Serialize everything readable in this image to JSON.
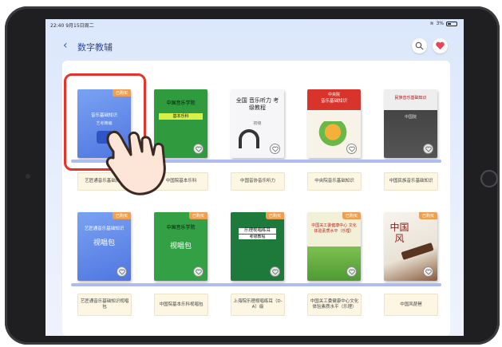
{
  "status_bar": {
    "time": "22:40  9月15日周二",
    "battery": "3%"
  },
  "header": {
    "back_icon": "chevron-left-icon",
    "title": "数字教辅",
    "search_icon": "search-icon",
    "favorite_icon": "heart-icon"
  },
  "colors": {
    "accent": "#2e4a9a",
    "favorite": "#e8455a",
    "highlight": "#e8332a",
    "shelf": "#aebcf0",
    "tag": "#f0a04b"
  },
  "books_row1": [
    {
      "cover_title": "音乐基础知识",
      "cover_sub": "艺考精编",
      "tag": "已购买",
      "label": "艺匠通音乐基础知识"
    },
    {
      "cover_title": "中国音乐学院",
      "cover_sub": "基本乐科",
      "tag": "",
      "label": "中国院基本乐科"
    },
    {
      "cover_title": "全国 音乐听力 考级教程",
      "cover_sub": "初级",
      "tag": "",
      "label": "中国音协音乐听力"
    },
    {
      "cover_title": "音乐基础知识",
      "cover_sub": "中央院",
      "tag": "",
      "label": "中央院音乐基础知识"
    },
    {
      "cover_title": "民族音乐基础知识",
      "cover_sub": "中国院",
      "tag": "",
      "label": "中国民族音乐基础知识"
    }
  ],
  "books_row2": [
    {
      "cover_title": "艺匠通音乐基础知识",
      "cover_sub": "视唱包",
      "tag": "已购买",
      "label": "艺匠通音乐基础知识视唱包"
    },
    {
      "cover_title": "中国音乐学院",
      "cover_sub": "视唱包",
      "tag": "已购买",
      "label": "中国院基本乐科视唱包"
    },
    {
      "cover_title": "乐理视唱练耳",
      "cover_sub": "考级教程",
      "tag": "已购买",
      "label": "上海院乐理视唱练耳（D-A）级"
    },
    {
      "cover_title": "中国关工委健康中心 文化体验素质水平（乐理）",
      "cover_sub": "",
      "tag": "已购买",
      "label": "中国关工委健康中心文化体验素质水平（乐理）"
    },
    {
      "cover_title": "中国风",
      "cover_sub": "",
      "tag": "已购买",
      "label": "中国风琵琶"
    }
  ]
}
